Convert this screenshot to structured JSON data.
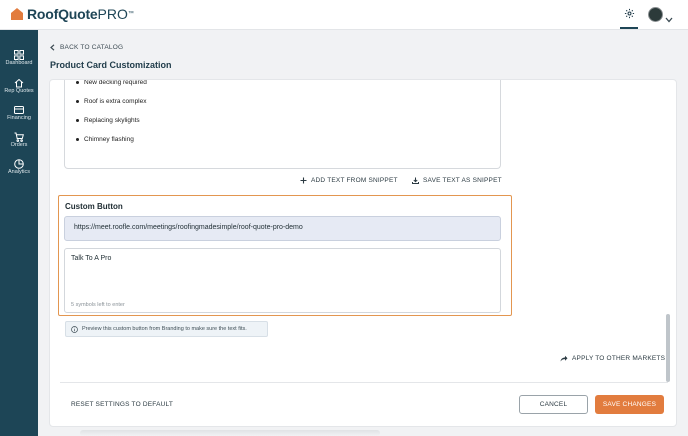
{
  "app": {
    "logo_main": "RoofQuote",
    "logo_pro": "PRO",
    "logo_tm": "™"
  },
  "colors": {
    "sidebar": "#1d4556",
    "accent": "#e27c3e",
    "highlight_border": "#e39650",
    "url_field_bg": "#e6eaf4"
  },
  "sidebar": {
    "items": [
      {
        "label": "Dashboard",
        "icon": "dashboard-icon"
      },
      {
        "label": "Rep Quotes",
        "icon": "rep-quotes-icon"
      },
      {
        "label": "Financing",
        "icon": "financing-icon"
      },
      {
        "label": "Orders",
        "icon": "orders-icon"
      },
      {
        "label": "Analytics",
        "icon": "analytics-icon"
      }
    ]
  },
  "header": {
    "back_label": "BACK TO CATALOG",
    "page_title": "Product Card Customization"
  },
  "description": {
    "bullets": [
      "New decking required",
      "Roof is extra complex",
      "Replacing skylights",
      "Chimney flashing"
    ],
    "add_snippet_label": "ADD TEXT FROM SNIPPET",
    "save_snippet_label": "SAVE TEXT AS SNIPPET"
  },
  "custom_button": {
    "title": "Custom Button",
    "url": "https://meet.roofle.com/meetings/roofingmadesimple/roof-quote-pro-demo",
    "label": "Talk To A Pro",
    "hint": "5 symbols left to enter",
    "note": "Preview this custom button from Branding to make sure the text fits."
  },
  "actions": {
    "apply_label": "APPLY TO OTHER MARKETS",
    "reset_label": "RESET SETTINGS TO DEFAULT",
    "cancel_label": "CANCEL",
    "save_label": "SAVE CHANGES"
  }
}
